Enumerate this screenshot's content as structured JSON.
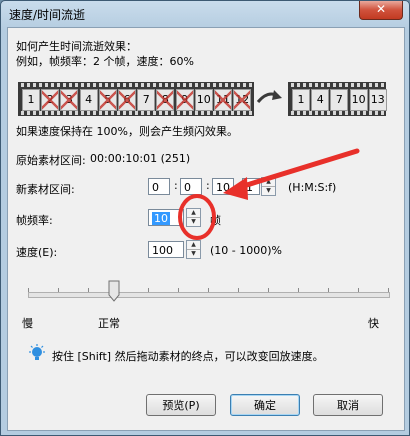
{
  "window": {
    "title": "速度/时间流逝",
    "close_glyph": "✕"
  },
  "intro": {
    "line1": "如何产生时间流逝效果：",
    "line2": "例如，帧频率：2 个帧，速度：60%"
  },
  "film_left": [
    {
      "n": "1",
      "x": false
    },
    {
      "n": "2",
      "x": true
    },
    {
      "n": "3",
      "x": true
    },
    {
      "n": "4",
      "x": false
    },
    {
      "n": "5",
      "x": true
    },
    {
      "n": "6",
      "x": true
    },
    {
      "n": "7",
      "x": false
    },
    {
      "n": "8",
      "x": true
    },
    {
      "n": "9",
      "x": true
    },
    {
      "n": "10",
      "x": false
    },
    {
      "n": "11",
      "x": true
    },
    {
      "n": "12",
      "x": true
    }
  ],
  "film_right": [
    "1",
    "4",
    "7",
    "10",
    "13"
  ],
  "note": "如果速度保持在 100%，则会产生频闪效果。",
  "original_range": {
    "label": "原始素材区间:",
    "value": "00:00:10:01 (251)"
  },
  "new_range": {
    "label": "新素材区间:",
    "h": "0",
    "m": "0",
    "s": "10",
    "f": "1",
    "format": "(H:M:S:f)"
  },
  "frame_rate": {
    "label": "帧频率:",
    "value": "10",
    "unit": "帧"
  },
  "speed": {
    "label": "速度(E):",
    "value": "100",
    "range": "(10 - 1000)%"
  },
  "slider": {
    "left": "慢",
    "mid": "正常",
    "right": "快"
  },
  "tip": "按住 [Shift] 然后拖动素材的终点，可以改变回放速度。",
  "buttons": {
    "preview": "预览(P)",
    "ok": "确定",
    "cancel": "取消"
  },
  "accent": {
    "annotation": "#e8302a",
    "highlight": "#3399ff"
  }
}
